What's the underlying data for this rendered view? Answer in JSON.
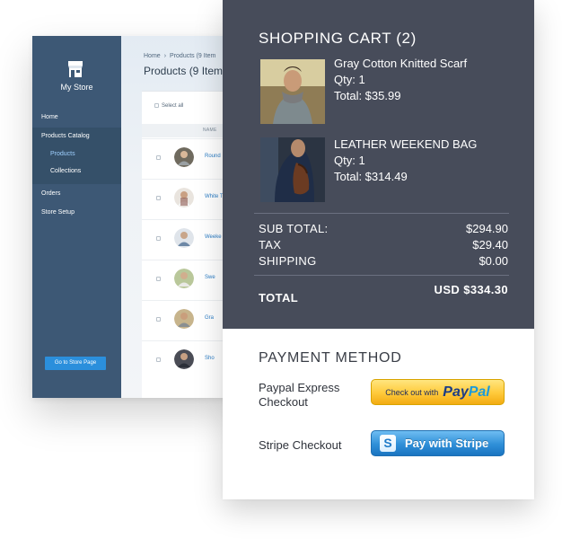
{
  "admin": {
    "store_name": "My Store",
    "breadcrumb": [
      "Home",
      "Products (9 Item"
    ],
    "page_title": "Products (9 Item",
    "select_all": "Select all",
    "column_header": "NAME",
    "nav": {
      "home": "Home",
      "products_catalog": "Products Catalog",
      "products": "Products",
      "collections": "Collections",
      "orders": "Orders",
      "store_setup": "Store Setup"
    },
    "goto_button": "Go to Store Page",
    "rows": [
      {
        "text": "Round"
      },
      {
        "text": "White T"
      },
      {
        "text": "Weeke"
      },
      {
        "text": "Swe"
      },
      {
        "text": "Gra"
      },
      {
        "text": "Sho"
      }
    ]
  },
  "cart": {
    "title": "SHOPPING CART (2)",
    "items": [
      {
        "name": "Gray Cotton Knitted Scarf",
        "qty": "Qty: 1",
        "total": "Total: $35.99"
      },
      {
        "name": "LEATHER WEEKEND BAG",
        "qty": "Qty: 1",
        "total": "Total: $314.49"
      }
    ],
    "subtotal_label": "SUB TOTAL:",
    "subtotal_value": "$294.90",
    "tax_label": "TAX",
    "tax_value": "$29.40",
    "shipping_label": "SHIPPING",
    "shipping_value": "$0.00",
    "total_label": "TOTAL",
    "total_value": "USD $334.30"
  },
  "payment": {
    "title": "PAYMENT METHOD",
    "paypal_label": "Paypal Express Checkout",
    "paypal_button_prefix": "Check out with",
    "paypal_logo_a": "Pay",
    "paypal_logo_b": "Pal",
    "stripe_label": "Stripe Checkout",
    "stripe_icon": "S",
    "stripe_button": "Pay with Stripe"
  },
  "colors": {
    "sidebar": "#3d5875",
    "cart_dark": "#474c5a",
    "paypal_yellow": "#ffc93a",
    "stripe_blue": "#2f8fd8"
  }
}
